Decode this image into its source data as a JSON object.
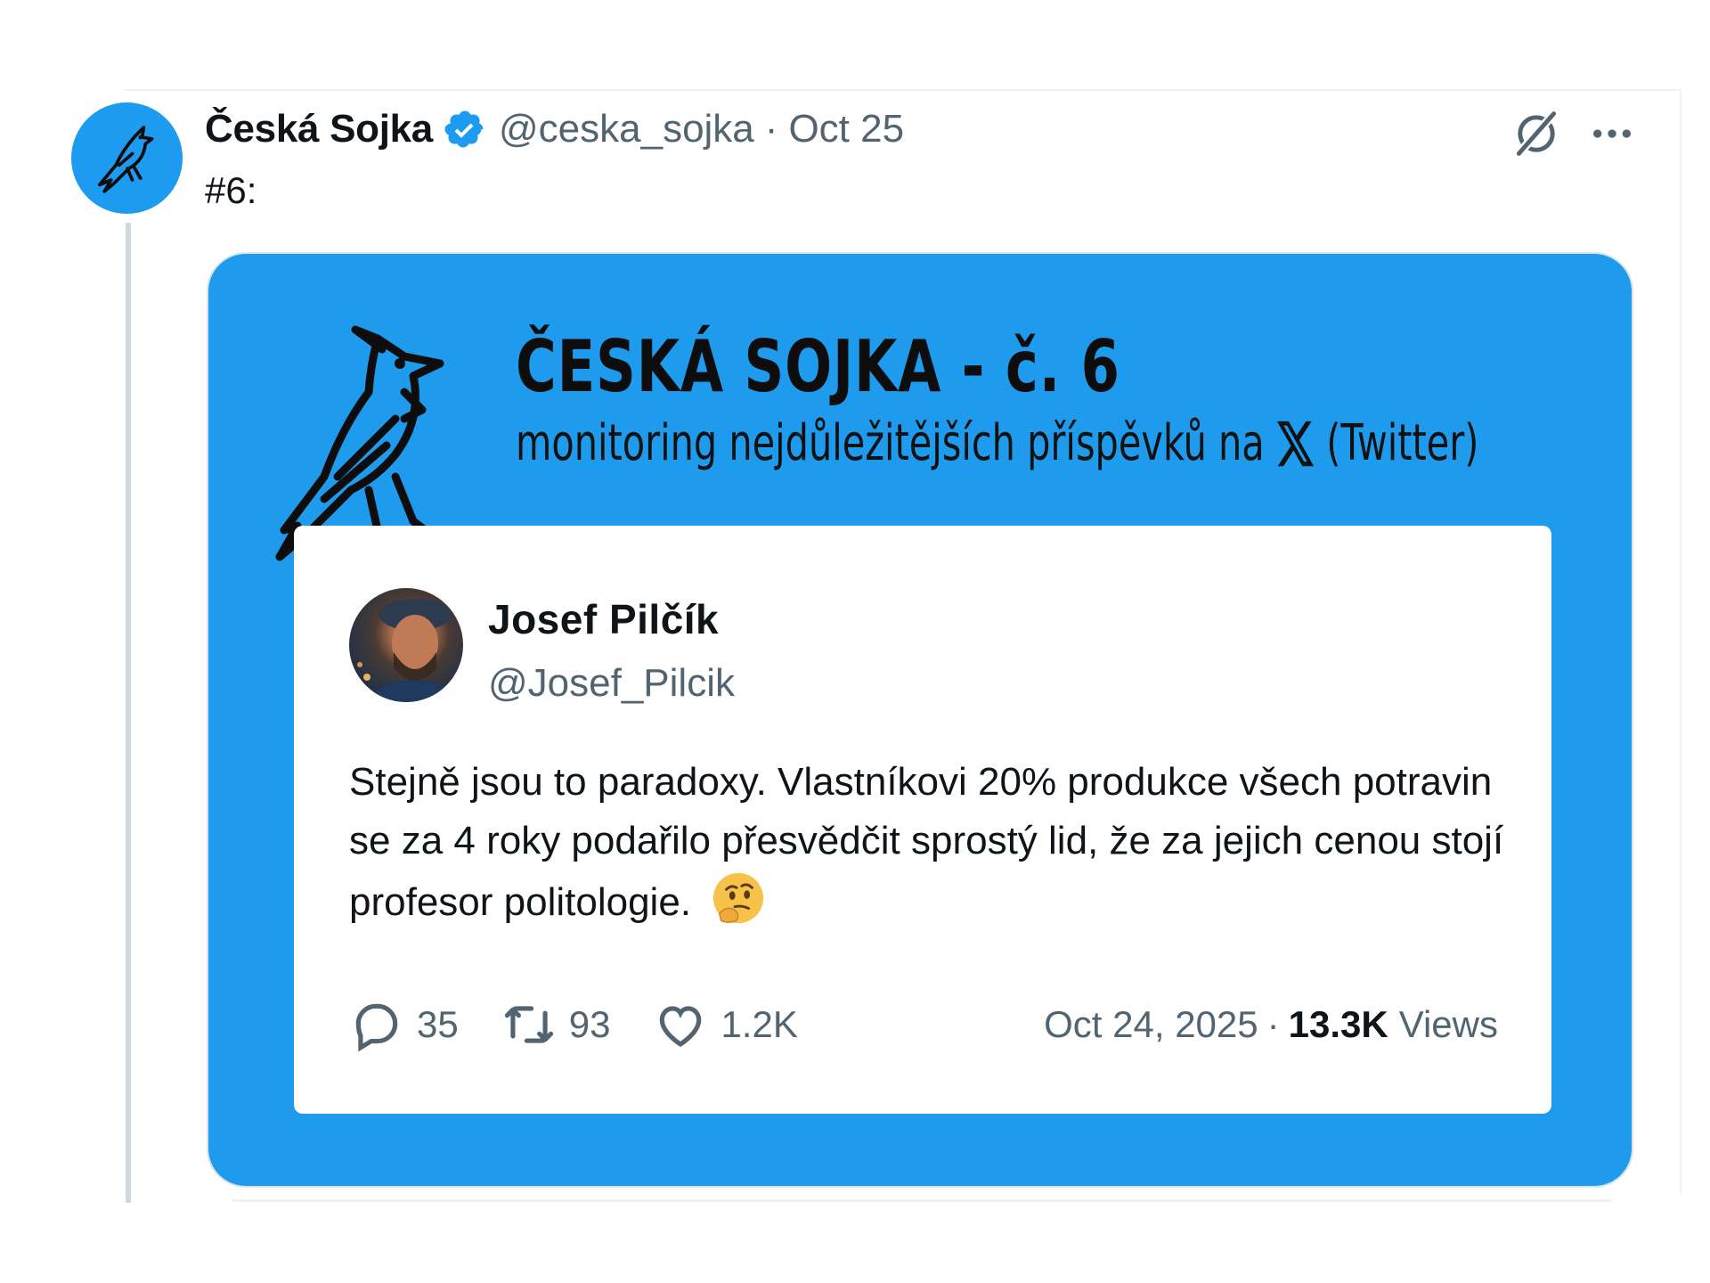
{
  "tweet": {
    "display_name": "Česká Sojka",
    "handle": "@ceska_sojka",
    "separator": "·",
    "date": "Oct 25",
    "text": "#6:",
    "verified": true
  },
  "icons": {
    "avatar": "jay-bird-logo",
    "verified": "verified-badge-icon",
    "grok": "grok-icon",
    "more": "more-icon"
  },
  "media": {
    "title": "ČESKÁ SOJKA - č. 6",
    "subtitle_before": "monitoring nejdůležitějších příspěvků na",
    "subtitle_after": "(Twitter)",
    "background": "#1f9bee",
    "quoted_tweet": {
      "author_name": "Josef Pilčík",
      "author_handle": "@Josef_Pilcik",
      "body": "Stejně jsou to paradoxy. Vlastníkovi 20% produkce všech potravin se za 4 roky podařilo přesvědčit sprostý lid, že za jejich cenou stojí profesor politologie.",
      "emoji": "thinking-face",
      "replies": "35",
      "reposts": "93",
      "likes": "1.2K",
      "date": "Oct 24, 2025",
      "separator": "·",
      "views_count": "13.3K",
      "views_label": "Views"
    }
  },
  "colors": {
    "brand_blue": "#1d9bf0",
    "text_primary": "#0f1419",
    "text_secondary": "#536471"
  }
}
